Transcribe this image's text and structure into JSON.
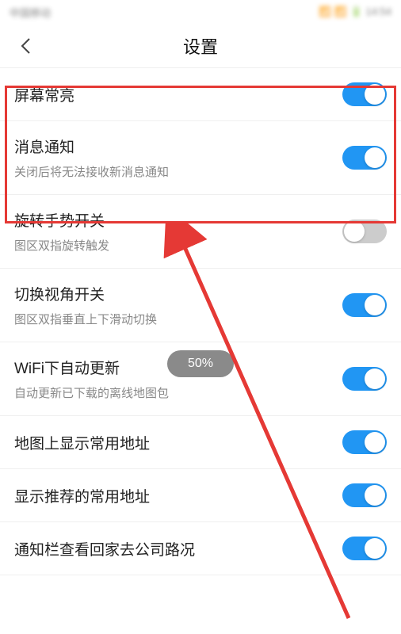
{
  "statusBar": {
    "carrier": "中国移动",
    "indicators": "📶 📶 🔋 14:54"
  },
  "header": {
    "title": "设置"
  },
  "settings": [
    {
      "title": "屏幕常亮",
      "subtitle": "",
      "on": true
    },
    {
      "title": "消息通知",
      "subtitle": "关闭后将无法接收新消息通知",
      "on": true
    },
    {
      "title": "旋转手势开关",
      "subtitle": "图区双指旋转触发",
      "on": false
    },
    {
      "title": "切换视角开关",
      "subtitle": "图区双指垂直上下滑动切换",
      "on": true
    },
    {
      "title": "WiFi下自动更新",
      "subtitle": "自动更新已下载的离线地图包",
      "on": true
    },
    {
      "title": "地图上显示常用地址",
      "subtitle": "",
      "on": true
    },
    {
      "title": "显示推荐的常用地址",
      "subtitle": "",
      "on": true
    },
    {
      "title": "通知栏查看回家去公司路况",
      "subtitle": "",
      "on": true
    }
  ],
  "toast": {
    "text": "50%"
  }
}
